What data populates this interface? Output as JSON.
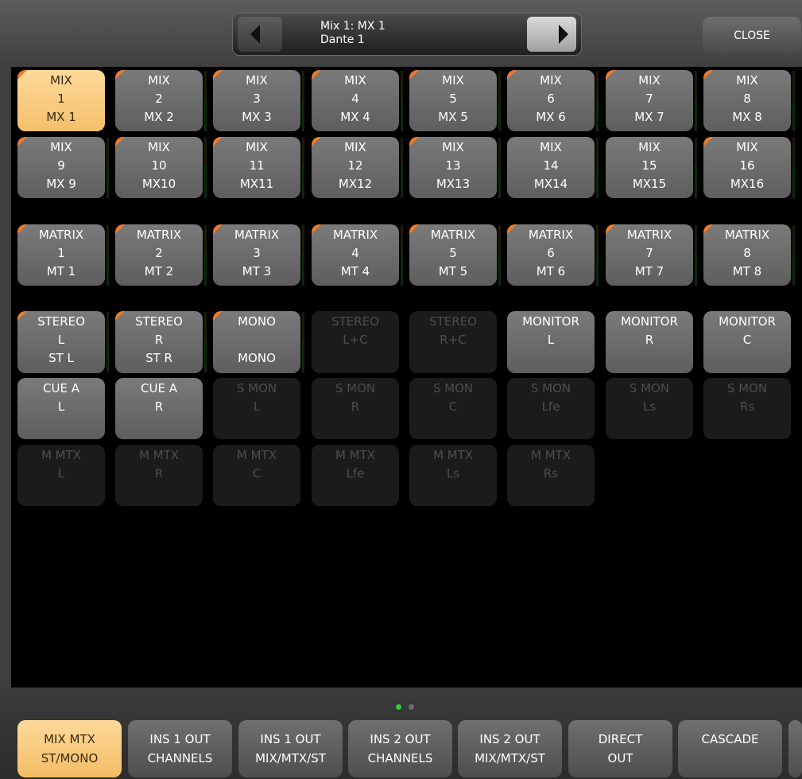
{
  "header": {
    "selector_line1": "Mix 1: MX 1",
    "selector_line2": "Dante 1",
    "close_label": "CLOSE"
  },
  "rows": [
    [
      {
        "l1": "MIX",
        "l2": "1",
        "l3": "MX 1",
        "state": "selected",
        "corner": true,
        "meter": false
      },
      {
        "l1": "MIX",
        "l2": "2",
        "l3": "MX 2",
        "state": "on",
        "corner": true,
        "meter": true
      },
      {
        "l1": "MIX",
        "l2": "3",
        "l3": "MX 3",
        "state": "on",
        "corner": true,
        "meter": true
      },
      {
        "l1": "MIX",
        "l2": "4",
        "l3": "MX 4",
        "state": "on",
        "corner": true,
        "meter": true
      },
      {
        "l1": "MIX",
        "l2": "5",
        "l3": "MX 5",
        "state": "on",
        "corner": true,
        "meter": true
      },
      {
        "l1": "MIX",
        "l2": "6",
        "l3": "MX 6",
        "state": "on",
        "corner": true,
        "meter": true
      },
      {
        "l1": "MIX",
        "l2": "7",
        "l3": "MX 7",
        "state": "on",
        "corner": true,
        "meter": true
      },
      {
        "l1": "MIX",
        "l2": "8",
        "l3": "MX 8",
        "state": "on",
        "corner": true,
        "meter": true
      }
    ],
    [
      {
        "l1": "MIX",
        "l2": "9",
        "l3": "MX 9",
        "state": "on",
        "corner": true,
        "meter": true
      },
      {
        "l1": "MIX",
        "l2": "10",
        "l3": "MX10",
        "state": "on",
        "corner": true,
        "meter": true
      },
      {
        "l1": "MIX",
        "l2": "11",
        "l3": "MX11",
        "state": "on",
        "corner": true,
        "meter": true
      },
      {
        "l1": "MIX",
        "l2": "12",
        "l3": "MX12",
        "state": "on",
        "corner": true,
        "meter": true
      },
      {
        "l1": "MIX",
        "l2": "13",
        "l3": "MX13",
        "state": "on",
        "corner": true,
        "meter": true
      },
      {
        "l1": "MIX",
        "l2": "14",
        "l3": "MX14",
        "state": "on",
        "corner": false,
        "meter": true
      },
      {
        "l1": "MIX",
        "l2": "15",
        "l3": "MX15",
        "state": "on",
        "corner": false,
        "meter": true
      },
      {
        "l1": "MIX",
        "l2": "16",
        "l3": "MX16",
        "state": "on",
        "corner": true,
        "meter": true
      }
    ],
    [
      {
        "l1": "MATRIX",
        "l2": "1",
        "l3": "MT 1",
        "state": "on",
        "corner": true,
        "meter": true
      },
      {
        "l1": "MATRIX",
        "l2": "2",
        "l3": "MT 2",
        "state": "on",
        "corner": true,
        "meter": true
      },
      {
        "l1": "MATRIX",
        "l2": "3",
        "l3": "MT 3",
        "state": "on",
        "corner": true,
        "meter": true
      },
      {
        "l1": "MATRIX",
        "l2": "4",
        "l3": "MT 4",
        "state": "on",
        "corner": true,
        "meter": true
      },
      {
        "l1": "MATRIX",
        "l2": "5",
        "l3": "MT 5",
        "state": "on",
        "corner": true,
        "meter": true
      },
      {
        "l1": "MATRIX",
        "l2": "6",
        "l3": "MT 6",
        "state": "on",
        "corner": true,
        "meter": true
      },
      {
        "l1": "MATRIX",
        "l2": "7",
        "l3": "MT 7",
        "state": "on",
        "corner": true,
        "meter": true
      },
      {
        "l1": "MATRIX",
        "l2": "8",
        "l3": "MT 8",
        "state": "on",
        "corner": true,
        "meter": true
      }
    ],
    [
      {
        "l1": "STEREO",
        "l2": "L",
        "l3": "ST L",
        "state": "on",
        "corner": true,
        "meter": true
      },
      {
        "l1": "STEREO",
        "l2": "R",
        "l3": "ST R",
        "state": "on",
        "corner": true,
        "meter": true
      },
      {
        "l1": "MONO",
        "l2": "",
        "l3": "MONO",
        "state": "on",
        "corner": true,
        "meter": true
      },
      {
        "l1": "STEREO",
        "l2": "L+C",
        "l3": "",
        "state": "disabled",
        "corner": false,
        "meter": false
      },
      {
        "l1": "STEREO",
        "l2": "R+C",
        "l3": "",
        "state": "disabled",
        "corner": false,
        "meter": false
      },
      {
        "l1": "MONITOR",
        "l2": "L",
        "l3": "",
        "state": "on",
        "corner": false,
        "meter": false
      },
      {
        "l1": "MONITOR",
        "l2": "R",
        "l3": "",
        "state": "on",
        "corner": false,
        "meter": false
      },
      {
        "l1": "MONITOR",
        "l2": "C",
        "l3": "",
        "state": "on",
        "corner": false,
        "meter": false
      }
    ],
    [
      {
        "l1": "CUE A",
        "l2": "L",
        "l3": "",
        "state": "on",
        "corner": false,
        "meter": false
      },
      {
        "l1": "CUE A",
        "l2": "R",
        "l3": "",
        "state": "on",
        "corner": false,
        "meter": false
      },
      {
        "l1": "S MON",
        "l2": "L",
        "l3": "",
        "state": "disabled",
        "corner": false,
        "meter": false
      },
      {
        "l1": "S MON",
        "l2": "R",
        "l3": "",
        "state": "disabled",
        "corner": false,
        "meter": false
      },
      {
        "l1": "S MON",
        "l2": "C",
        "l3": "",
        "state": "disabled",
        "corner": false,
        "meter": false
      },
      {
        "l1": "S MON",
        "l2": "Lfe",
        "l3": "",
        "state": "disabled",
        "corner": false,
        "meter": false
      },
      {
        "l1": "S MON",
        "l2": "Ls",
        "l3": "",
        "state": "disabled",
        "corner": false,
        "meter": false
      },
      {
        "l1": "S MON",
        "l2": "Rs",
        "l3": "",
        "state": "disabled",
        "corner": false,
        "meter": false
      }
    ],
    [
      {
        "l1": "M MTX",
        "l2": "L",
        "l3": "",
        "state": "disabled",
        "corner": false,
        "meter": false
      },
      {
        "l1": "M MTX",
        "l2": "R",
        "l3": "",
        "state": "disabled",
        "corner": false,
        "meter": false
      },
      {
        "l1": "M MTX",
        "l2": "C",
        "l3": "",
        "state": "disabled",
        "corner": false,
        "meter": false
      },
      {
        "l1": "M MTX",
        "l2": "Lfe",
        "l3": "",
        "state": "disabled",
        "corner": false,
        "meter": false
      },
      {
        "l1": "M MTX",
        "l2": "Ls",
        "l3": "",
        "state": "disabled",
        "corner": false,
        "meter": false
      },
      {
        "l1": "M MTX",
        "l2": "Rs",
        "l3": "",
        "state": "disabled",
        "corner": false,
        "meter": false
      }
    ]
  ],
  "page_dots": [
    {
      "active": true
    },
    {
      "active": false
    }
  ],
  "tabs": [
    {
      "l1": "MIX MTX",
      "l2": "ST/MONO",
      "selected": true
    },
    {
      "l1": "INS 1 OUT",
      "l2": "CHANNELS",
      "selected": false
    },
    {
      "l1": "INS 1 OUT",
      "l2": "MIX/MTX/ST",
      "selected": false
    },
    {
      "l1": "INS 2 OUT",
      "l2": "CHANNELS",
      "selected": false
    },
    {
      "l1": "INS 2 OUT",
      "l2": "MIX/MTX/ST",
      "selected": false
    },
    {
      "l1": "DIRECT",
      "l2": "OUT",
      "selected": false
    },
    {
      "l1": "CASCADE",
      "l2": "",
      "selected": false
    },
    {
      "l1": "",
      "l2": "",
      "selected": false
    }
  ],
  "colors": {
    "selected_bg": "#f4c06b",
    "corner_marker": "#f07a2a",
    "active_dot": "#2dd12d",
    "inactive_dot": "#6a6a6a"
  }
}
